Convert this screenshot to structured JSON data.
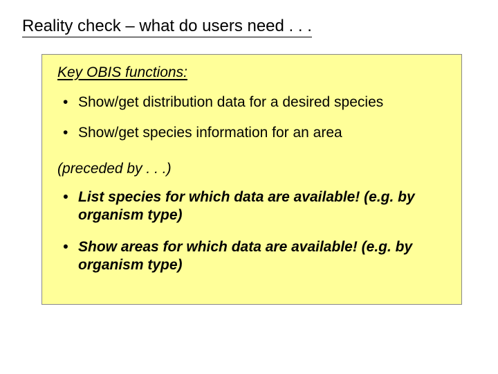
{
  "title": "Reality check – what do users need . . .",
  "box": {
    "heading": "Key OBIS functions:",
    "items": [
      "Show/get distribution data for a desired species",
      "Show/get species information for an area"
    ],
    "subheading": "(preceded by . . .)",
    "bold_items": [
      "List species for which data are available! (e.g. by organism type)",
      "Show areas for which data are available! (e.g. by organism type)"
    ]
  }
}
